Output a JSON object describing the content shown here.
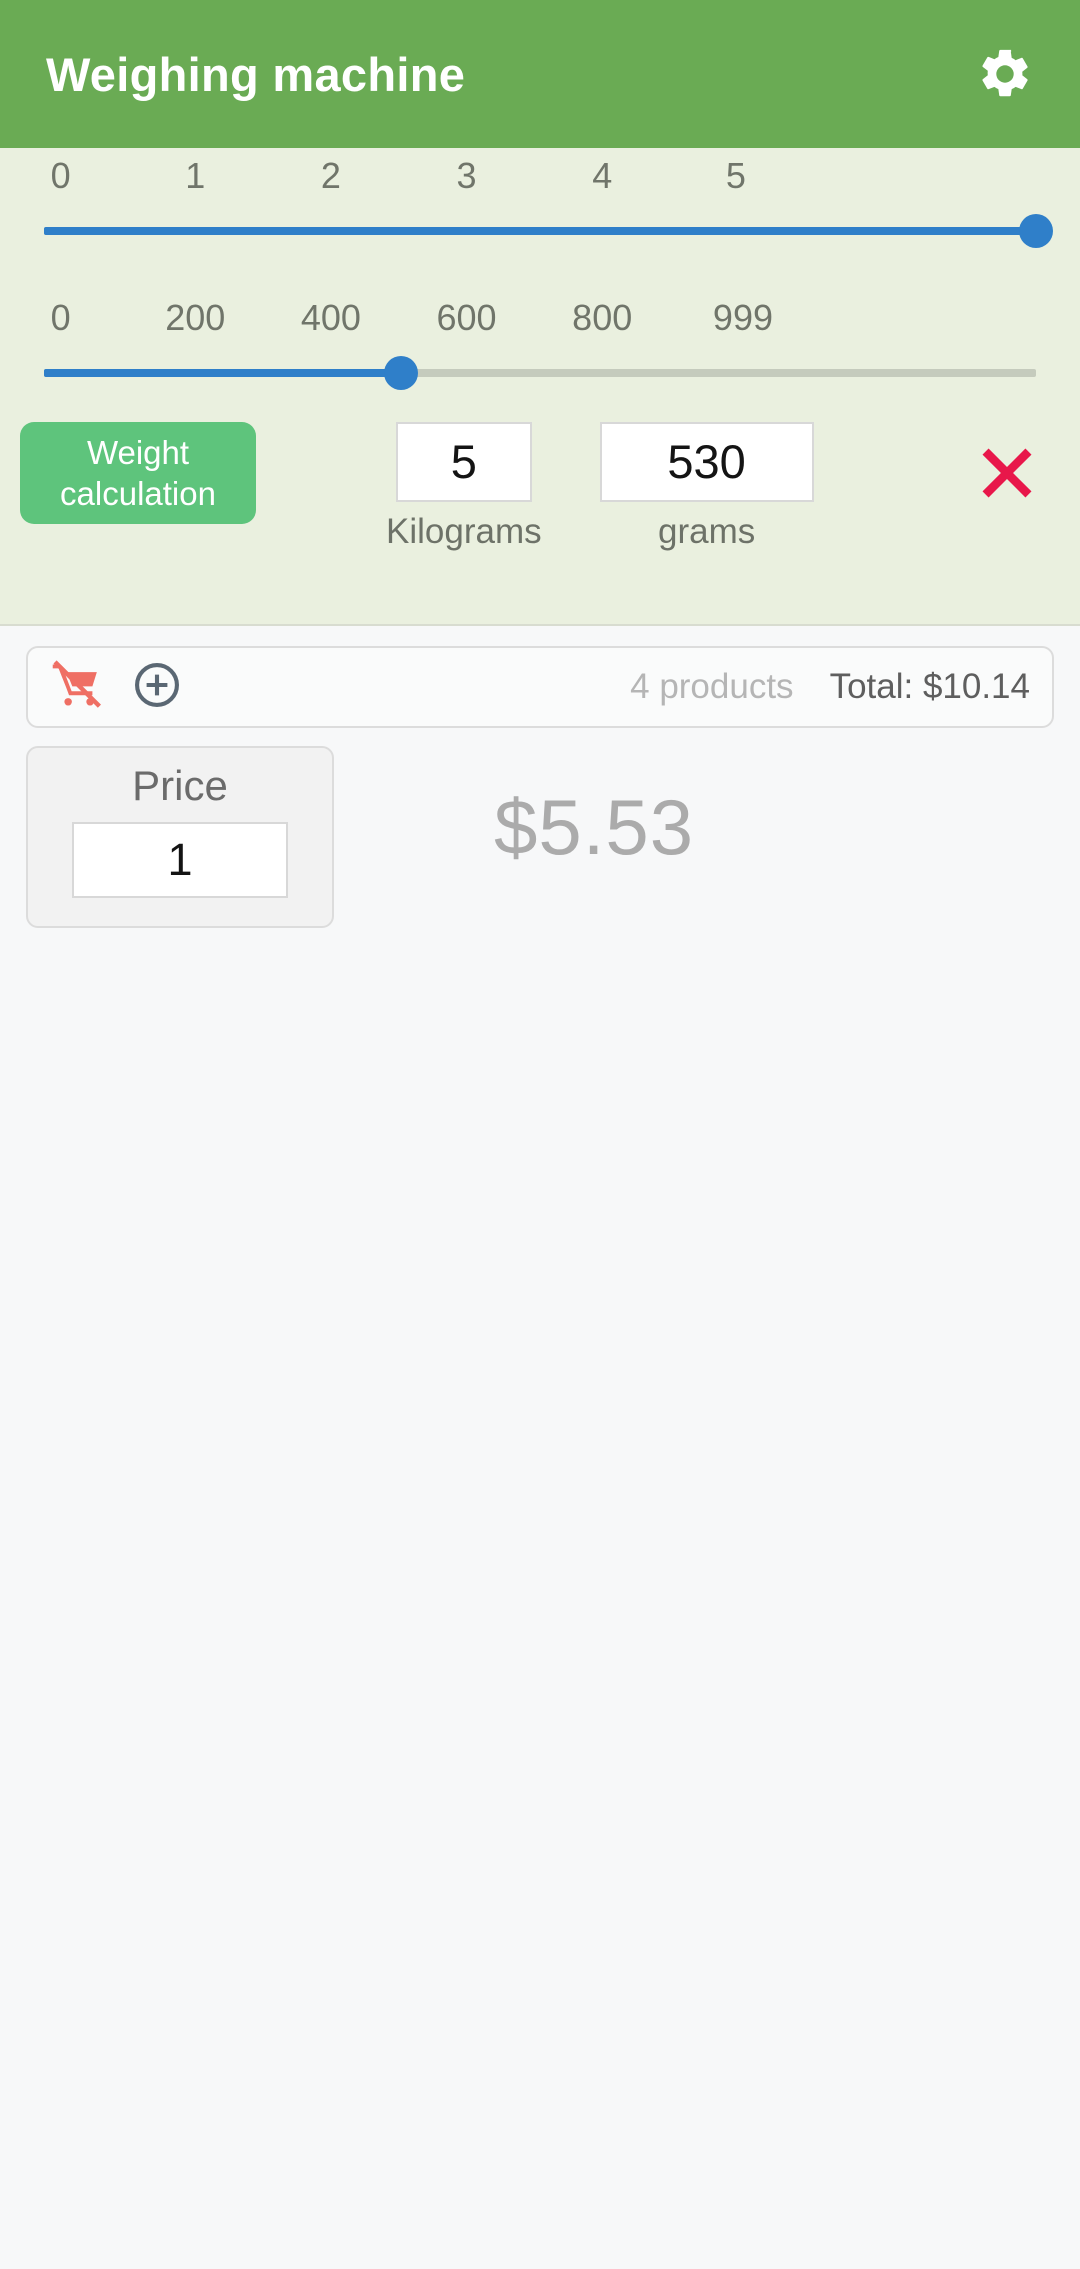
{
  "header": {
    "title": "Weighing machine",
    "settings_icon": "gear-icon",
    "background_color": "#6aab54",
    "title_color": "#ffffff"
  },
  "kilogram_slider": {
    "ticks": [
      "0",
      "1",
      "2",
      "3",
      "4",
      "5"
    ],
    "min": 0,
    "max": 5,
    "value": 5,
    "fill_percent": 100,
    "active_color": "#2f7fc9",
    "inactive_color": "#c5cbbd"
  },
  "gram_slider": {
    "ticks": [
      "0",
      "200",
      "400",
      "600",
      "800",
      "999"
    ],
    "min": 0,
    "max": 999,
    "value": 530,
    "fill_percent": 53,
    "active_color": "#2f7fc9",
    "inactive_color": "#c5cbbd"
  },
  "weight_row": {
    "calculate_button_line1": "Weight",
    "calculate_button_line2": "calculation",
    "calculate_button_color": "#5ec47c",
    "kilograms_value": "5",
    "kilograms_label": "Kilograms",
    "grams_value": "530",
    "grams_label": "grams",
    "clear_icon": "red-x-icon",
    "clear_icon_color": "#e8174a"
  },
  "cart_bar": {
    "clear_cart_icon": "cart-off-icon",
    "clear_cart_icon_color": "#ef6f64",
    "add_icon": "plus-circle-icon",
    "add_icon_color": "#5a6773",
    "products_text": "4 products",
    "total_text": "Total: $10.14"
  },
  "price_section": {
    "price_label": "Price",
    "price_value": "1",
    "unit_price": "$5.53",
    "unit_price_color": "#ababab"
  }
}
